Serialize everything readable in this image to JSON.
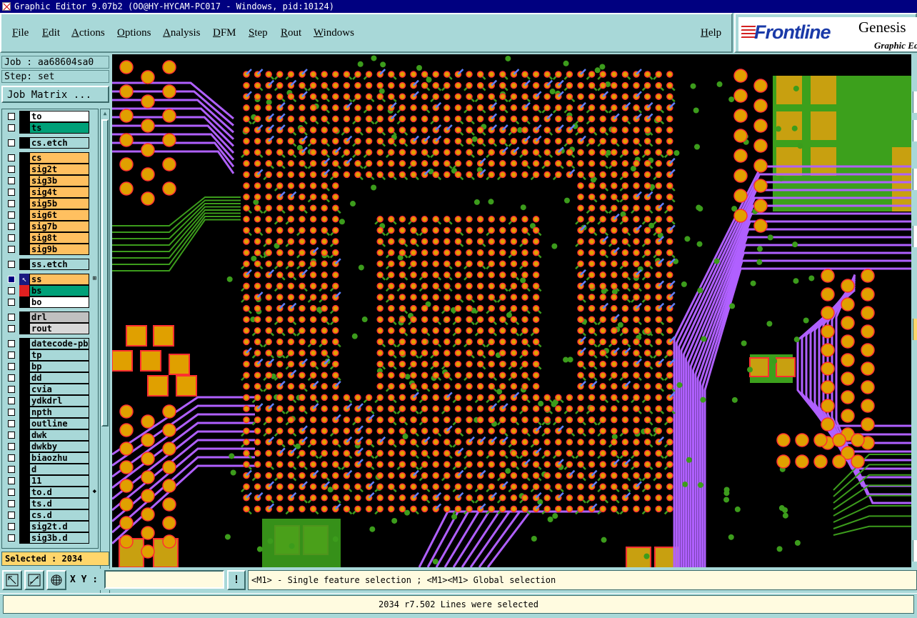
{
  "window": {
    "title": "Graphic Editor 9.07b2 (OO@HY-HYCAM-PC017 - Windows, pid:10124)"
  },
  "menu": {
    "items": [
      "File",
      "Edit",
      "Actions",
      "Options",
      "Analysis",
      "DFM",
      "Step",
      "Rout",
      "Windows"
    ],
    "help": "Help"
  },
  "logo": {
    "brand": "Frontline",
    "product": "Genesis",
    "subtitle": "Graphic Editor"
  },
  "job": {
    "job_line": "Job : aa68604sa0",
    "step_line": "Step: set",
    "matrix_button": "Job Matrix ..."
  },
  "layers": [
    {
      "name": "to",
      "color": "#ffffff"
    },
    {
      "name": "ts",
      "color": "#00a078"
    },
    {
      "name": "cs.etch",
      "color": "#a8d8d8"
    },
    {
      "name": "cs",
      "color": "#ffc060"
    },
    {
      "name": "sig2t",
      "color": "#ffc060"
    },
    {
      "name": "sig3b",
      "color": "#ffc060"
    },
    {
      "name": "sig4t",
      "color": "#ffc060"
    },
    {
      "name": "sig5b",
      "color": "#ffc060"
    },
    {
      "name": "sig6t",
      "color": "#ffc060"
    },
    {
      "name": "sig7b",
      "color": "#ffc060"
    },
    {
      "name": "sig8t",
      "color": "#ffc060"
    },
    {
      "name": "sig9b",
      "color": "#ffc060"
    },
    {
      "name": "ss.etch",
      "color": "#a8d8d8"
    },
    {
      "name": "ss",
      "color": "#ffc060",
      "active": true
    },
    {
      "name": "bs",
      "color": "#00a078",
      "red": true
    },
    {
      "name": "bo",
      "color": "#ffffff"
    },
    {
      "name": "drl",
      "color": "#c0c0c0"
    },
    {
      "name": "rout",
      "color": "#d8d8d8"
    },
    {
      "name": "datecode-pbe",
      "color": "#a8d8d8"
    },
    {
      "name": "tp",
      "color": "#a8d8d8"
    },
    {
      "name": "bp",
      "color": "#a8d8d8"
    },
    {
      "name": "dd",
      "color": "#a8d8d8"
    },
    {
      "name": "cvia",
      "color": "#a8d8d8"
    },
    {
      "name": "ydkdrl",
      "color": "#a8d8d8"
    },
    {
      "name": "npth",
      "color": "#a8d8d8"
    },
    {
      "name": "outline",
      "color": "#a8d8d8"
    },
    {
      "name": "dwk",
      "color": "#a8d8d8"
    },
    {
      "name": "dwkby",
      "color": "#a8d8d8"
    },
    {
      "name": "biaozhu",
      "color": "#a8d8d8"
    },
    {
      "name": "d",
      "color": "#a8d8d8"
    },
    {
      "name": "11",
      "color": "#a8d8d8"
    },
    {
      "name": "to.d",
      "color": "#a8d8d8",
      "tail": "◆"
    },
    {
      "name": "ts.d",
      "color": "#a8d8d8"
    },
    {
      "name": "cs.d",
      "color": "#a8d8d8"
    },
    {
      "name": "sig2t.d",
      "color": "#a8d8d8"
    },
    {
      "name": "sig3b.d",
      "color": "#a8d8d8"
    }
  ],
  "selected": "Selected : 2034",
  "command": {
    "xy_label": "X Y :",
    "xy_value": "",
    "alert": "!",
    "hint": "<M1> - Single feature selection ; <M1><M1> Global selection"
  },
  "status": "2034 r7.502 Lines were selected",
  "colors": {
    "pad_fill": "#e0a000",
    "pad_ring": "#ff3030",
    "trace_green": "#3c9c1c",
    "trace_purple": "#b060ff",
    "via_blue": "#6080ff",
    "copper": "#c8a010",
    "plane_green": "#3ca01c"
  }
}
